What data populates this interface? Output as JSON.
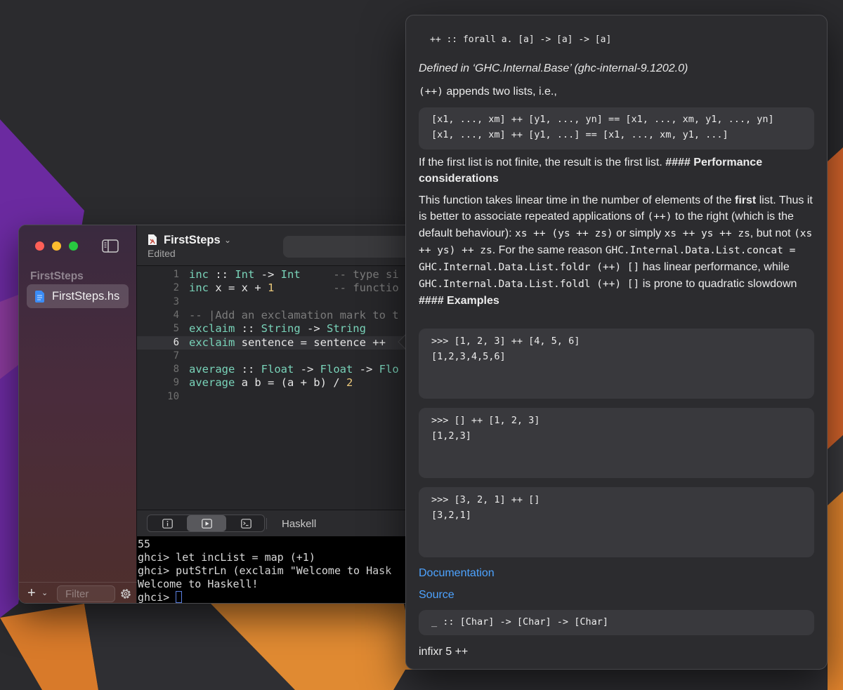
{
  "colors": {
    "accent_link": "#4da3ff",
    "code_keyword": "#79d3b9",
    "code_number": "#e9c77a",
    "code_comment": "#7b7b7b",
    "cursor": "#5a7fe0"
  },
  "sidebar": {
    "section_title": "FirstSteps",
    "file_label": "FirstSteps.hs",
    "file_icon": "haskell-file-icon",
    "filter_placeholder": "Filter",
    "add_label": "+"
  },
  "editor": {
    "title": "FirstSteps",
    "subtitle": "Edited",
    "active_line": 6,
    "lines": [
      {
        "n": "1",
        "tokens": [
          {
            "c": "kw",
            "t": "inc"
          },
          {
            "c": "pl",
            "t": " :: "
          },
          {
            "c": "ty",
            "t": "Int"
          },
          {
            "c": "pl",
            "t": " -> "
          },
          {
            "c": "ty",
            "t": "Int"
          },
          {
            "c": "pl",
            "t": "     "
          },
          {
            "c": "cm",
            "t": "-- type si"
          }
        ]
      },
      {
        "n": "2",
        "tokens": [
          {
            "c": "kw",
            "t": "inc"
          },
          {
            "c": "pl",
            "t": " x = x + "
          },
          {
            "c": "num",
            "t": "1"
          },
          {
            "c": "pl",
            "t": "         "
          },
          {
            "c": "cm",
            "t": "-- functio"
          }
        ]
      },
      {
        "n": "3",
        "tokens": []
      },
      {
        "n": "4",
        "tokens": [
          {
            "c": "cm",
            "t": "-- |Add an exclamation mark to t"
          }
        ]
      },
      {
        "n": "5",
        "tokens": [
          {
            "c": "kw",
            "t": "exclaim"
          },
          {
            "c": "pl",
            "t": " :: "
          },
          {
            "c": "ty",
            "t": "String"
          },
          {
            "c": "pl",
            "t": " -> "
          },
          {
            "c": "ty",
            "t": "String"
          }
        ]
      },
      {
        "n": "6",
        "tokens": [
          {
            "c": "kw",
            "t": "exclaim"
          },
          {
            "c": "pl",
            "t": " sentence = sentence ++"
          }
        ]
      },
      {
        "n": "7",
        "tokens": []
      },
      {
        "n": "8",
        "tokens": [
          {
            "c": "kw",
            "t": "average"
          },
          {
            "c": "pl",
            "t": " :: "
          },
          {
            "c": "ty",
            "t": "Float"
          },
          {
            "c": "pl",
            "t": " -> "
          },
          {
            "c": "ty",
            "t": "Float"
          },
          {
            "c": "pl",
            "t": " -> "
          },
          {
            "c": "ty",
            "t": "Flo"
          }
        ]
      },
      {
        "n": "9",
        "tokens": [
          {
            "c": "kw",
            "t": "average"
          },
          {
            "c": "pl",
            "t": " a b = (a + b) / "
          },
          {
            "c": "num",
            "t": "2"
          }
        ]
      },
      {
        "n": "10",
        "tokens": []
      }
    ]
  },
  "bottom_toolbar": {
    "buttons": [
      "info-icon",
      "play-icon",
      "terminal-icon"
    ],
    "language": "Haskell"
  },
  "terminal": {
    "lines": [
      "55",
      "ghci> let incList = map (+1)",
      "ghci> putStrLn (exclaim \"Welcome to Hask",
      "Welcome to Haskell!",
      "ghci> "
    ]
  },
  "popover": {
    "signature": "++ :: forall a. [a] -> [a] -> [a]",
    "defined_in": "Defined in ‘GHC.Internal.Base’ (ghc-internal-9.1202.0)",
    "intro_code": "(++)",
    "intro_text": " appends two lists, i.e.,",
    "example_code_lines": [
      "[x1, ..., xm] ++ [y1, ..., yn] == [x1, ..., xm, y1, ..., yn]",
      "[x1, ..., xm] ++ [y1, ...] == [x1, ..., xm, y1, ...]"
    ],
    "para_finite": "If the first list is not finite, the result is the first list. ",
    "para_finite_bold": "#### Performance considerations",
    "perf_1": "This function takes linear time in the number of elements of the ",
    "perf_bold": "first",
    "perf_2": " list. Thus it is better to associate repeated applications of ",
    "perf_code1": "(++)",
    "perf_3": " to the right (which is the default behaviour): ",
    "perf_code2": "xs ++ (ys ++ zs)",
    "perf_4": " or simply ",
    "perf_code3": "xs ++ ys ++ zs",
    "perf_5": ", but not ",
    "perf_code4": "(xs ++ ys) ++ zs",
    "perf_6": ". For the same reason ",
    "perf_code5": "GHC.Internal.Data.List.concat = GHC.Internal.Data.List.foldr (++) []",
    "perf_7": " has linear performance, while ",
    "perf_code6": "GHC.Internal.Data.List.foldl (++) []",
    "perf_8": " is prone to quadratic slowdown ",
    "perf_bold2": "#### Examples",
    "examples": [
      {
        "input": ">>> [1, 2, 3] ++ [4, 5, 6]",
        "output": "[1,2,3,4,5,6]"
      },
      {
        "input": ">>> [] ++ [1, 2, 3]",
        "output": "[1,2,3]"
      },
      {
        "input": ">>> [3, 2, 1] ++ []",
        "output": "[3,2,1]"
      }
    ],
    "documentation_link": "Documentation",
    "source_link": "Source",
    "specialized_sig": "_ :: [Char] -> [Char] -> [Char]",
    "fixity": "infixr 5 ++"
  }
}
